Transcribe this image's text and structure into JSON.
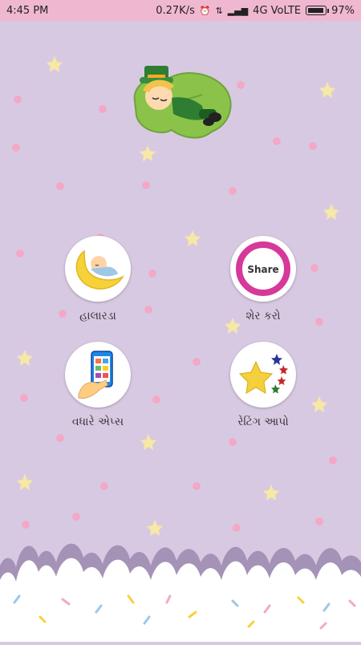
{
  "status_bar": {
    "time": "4:45 PM",
    "net_speed": "0.27K/s",
    "network": "4G VoLTE",
    "battery": "97%"
  },
  "menu": [
    {
      "id": "lullaby",
      "label": "હાલારડા"
    },
    {
      "id": "share",
      "label": "શેર કરો",
      "icon_text": "Share"
    },
    {
      "id": "more_apps",
      "label": "વધારે એપ્સ"
    },
    {
      "id": "rate",
      "label": "રેટિંગ આપો"
    }
  ],
  "colors": {
    "background": "#d8c9e3",
    "status_bar": "#f0b8d0",
    "share_ring": "#d6399a",
    "star_yellow": "#f6e8a5",
    "dot_pink": "#f2a9c6"
  }
}
